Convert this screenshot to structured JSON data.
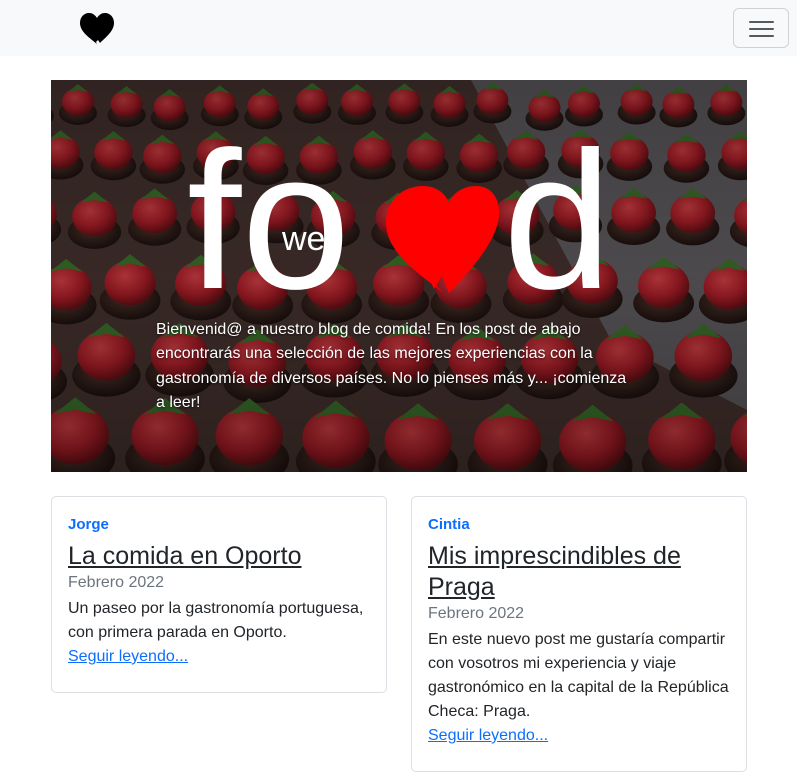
{
  "navbar": {
    "brand_icon": "heart-icon",
    "toggler_icon": "hamburger-icon"
  },
  "hero": {
    "logo_left": "fo",
    "logo_small": "we",
    "logo_right": "d",
    "logo_heart_color": "#ff0000",
    "intro": "Bienvenid@ a nuestro blog de comida! En los post de abajo encontrarás una selección de las mejores experiencias con la gastronomía de diversos países. No lo pienses más y... ¡comienza a leer!"
  },
  "posts": [
    {
      "author": "Jorge",
      "title": "La comida en Oporto",
      "date": "Febrero 2022",
      "excerpt": "Un paseo por la gastronomía portuguesa, con primera parada en Oporto.",
      "link": "Seguir leyendo..."
    },
    {
      "author": "Cintia",
      "title": "Mis imprescindibles de Praga",
      "date": "Febrero 2022",
      "excerpt": "En este nuevo post me gustaría compartir con vosotros mi experiencia y viaje gastronómico en la capital de la República Checa: Praga.",
      "link": "Seguir leyendo..."
    }
  ],
  "colors": {
    "accent": "#0d6efd",
    "navbar_bg": "#f8f9fa"
  }
}
